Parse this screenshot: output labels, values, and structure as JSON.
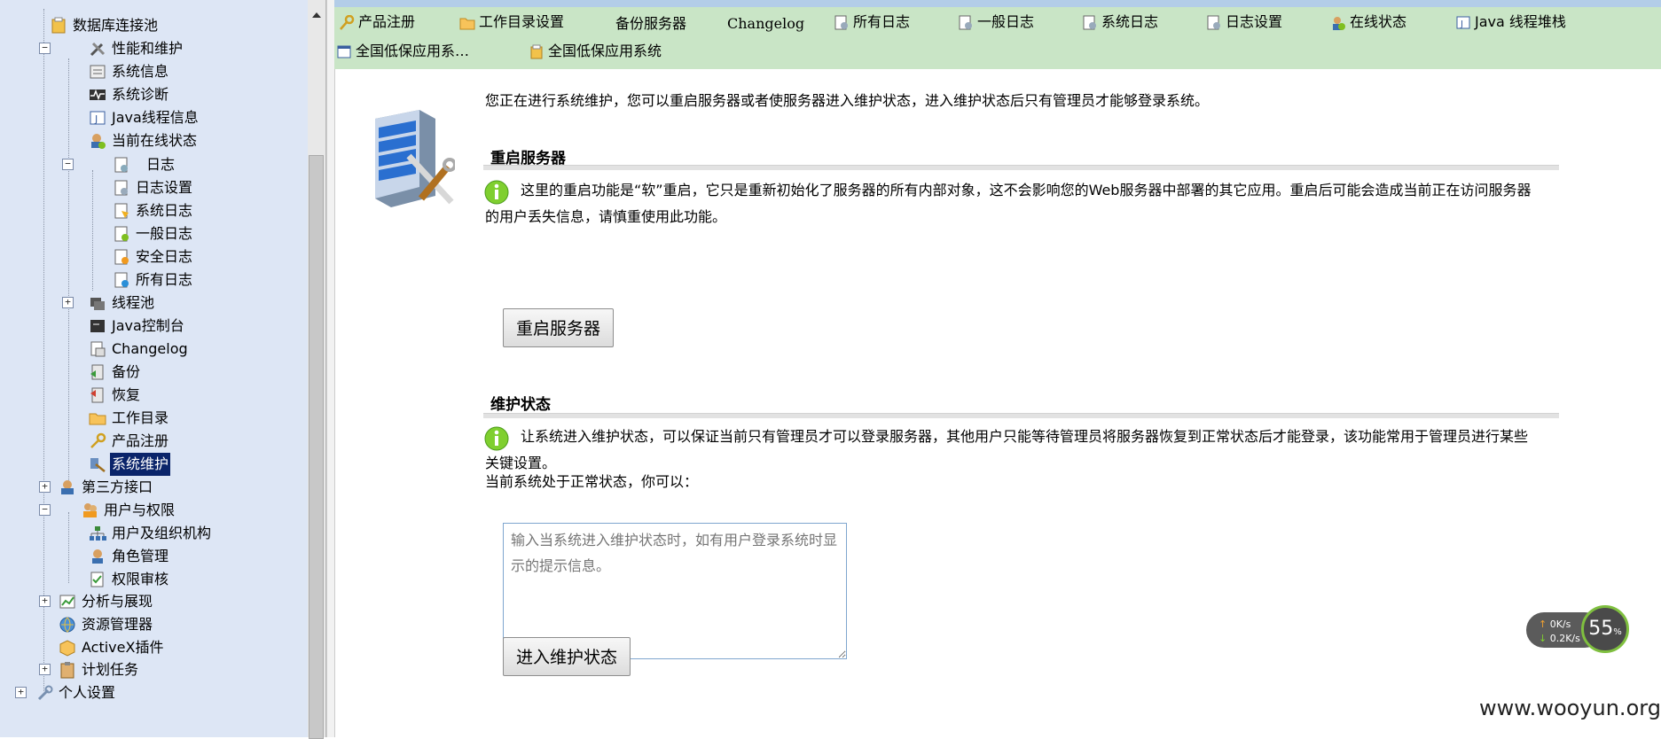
{
  "tree": {
    "items": [
      {
        "label": "数据库连接池",
        "icon": "db-icon"
      },
      {
        "label": "性能和维护",
        "icon": "tools-icon"
      },
      {
        "label": "系统信息",
        "icon": "info-icon"
      },
      {
        "label": "系统诊断",
        "icon": "pulse-icon"
      },
      {
        "label": "Java线程信息",
        "icon": "java-icon"
      },
      {
        "label": "当前在线状态",
        "icon": "online-icon"
      },
      {
        "label": "日志",
        "icon": "log-icon"
      },
      {
        "label": "日志设置",
        "icon": "log-settings-icon"
      },
      {
        "label": "系统日志",
        "icon": "log-system-icon"
      },
      {
        "label": "一般日志",
        "icon": "log-general-icon"
      },
      {
        "label": "安全日志",
        "icon": "log-security-icon"
      },
      {
        "label": "所有日志",
        "icon": "log-all-icon"
      },
      {
        "label": "线程池",
        "icon": "threadpool-icon"
      },
      {
        "label": "Java控制台",
        "icon": "console-icon"
      },
      {
        "label": "Changelog",
        "icon": "changelog-icon"
      },
      {
        "label": "备份",
        "icon": "backup-icon"
      },
      {
        "label": "恢复",
        "icon": "restore-icon"
      },
      {
        "label": "工作目录",
        "icon": "folder-icon"
      },
      {
        "label": "产品注册",
        "icon": "key-icon"
      },
      {
        "label": "系统维护",
        "icon": "maintenance-icon"
      },
      {
        "label": "第三方接口",
        "icon": "plugin-icon"
      },
      {
        "label": "用户与权限",
        "icon": "users-icon"
      },
      {
        "label": "用户及组织机构",
        "icon": "org-icon"
      },
      {
        "label": "角色管理",
        "icon": "role-icon"
      },
      {
        "label": "权限审核",
        "icon": "audit-icon"
      },
      {
        "label": "分析与展现",
        "icon": "chart-icon"
      },
      {
        "label": "资源管理器",
        "icon": "globe-icon"
      },
      {
        "label": "ActiveX插件",
        "icon": "box-icon"
      },
      {
        "label": "计划任务",
        "icon": "clipboard-icon"
      },
      {
        "label": "个人设置",
        "icon": "wrench-icon"
      }
    ]
  },
  "toolbar": {
    "items": [
      {
        "label": "产品注册",
        "icon": "key-icon"
      },
      {
        "label": "工作目录设置",
        "icon": "folder-icon"
      },
      {
        "label": "备份服务器",
        "icon": ""
      },
      {
        "label": "Changelog",
        "icon": ""
      },
      {
        "label": "所有日志",
        "icon": "log-icon"
      },
      {
        "label": "一般日志",
        "icon": "log-icon"
      },
      {
        "label": "系统日志",
        "icon": "log-icon"
      },
      {
        "label": "日志设置",
        "icon": "log-icon"
      },
      {
        "label": "在线状态",
        "icon": "online-icon"
      },
      {
        "label": "Java 线程堆栈",
        "icon": "java-icon"
      },
      {
        "label": "全国低保应用系…",
        "icon": "window-icon"
      },
      {
        "label": "全国低保应用系统",
        "icon": "db-icon"
      }
    ]
  },
  "main": {
    "intro": "您正在进行系统维护，您可以重启服务器或者使服务器进入维护状态，进入维护状态后只有管理员才能够登录系统。",
    "restart": {
      "title": "重启服务器",
      "info": "这里的重启功能是“软”重启，它只是重新初始化了服务器的所有内部对象，这不会影响您的Web服务器中部署的其它应用。重启后可能会造成当前正在访问服务器的用户丢失信息，请慎重使用此功能。",
      "button": "重启服务器"
    },
    "maintenance": {
      "title": "维护状态",
      "info": "让系统进入维护状态，可以保证当前只有管理员才可以登录服务器，其他用户只能等待管理员将服务器恢复到正常状态后才能登录，该功能常用于管理员进行某些关键设置。",
      "status": "当前系统处于正常状态，你可以：",
      "placeholder": "输入当系统进入维护状态时，如有用户登录系统时显示的提示信息。",
      "button": "进入维护状态"
    }
  },
  "network_widget": {
    "upload": "0K/s",
    "download": "0.2K/s",
    "percent": "55",
    "percent_unit": "%"
  },
  "watermark": "www.wooyun.org"
}
